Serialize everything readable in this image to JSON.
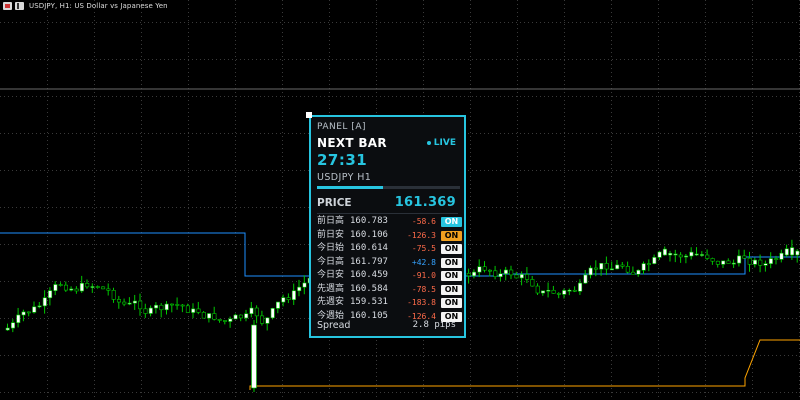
{
  "window": {
    "title": "USDJPY, H1:  US Dollar vs Japanese Yen"
  },
  "panel": {
    "label": "PANEL [A]",
    "heading": "NEXT BAR",
    "status": "LIVE",
    "timer": "27:31",
    "symbol": "USDJPY H1",
    "progress": 0.46,
    "price_label": "PRICE",
    "price_value": "161.369",
    "rows": [
      {
        "name": "前日高",
        "price": "160.783",
        "diff": "-58.6",
        "toggle": "ON",
        "toggle_color": "cyan"
      },
      {
        "name": "前日安",
        "price": "160.106",
        "diff": "-126.3",
        "toggle": "ON",
        "toggle_color": "orange"
      },
      {
        "name": "今日始",
        "price": "160.614",
        "diff": "-75.5",
        "toggle": "ON",
        "toggle_color": "white"
      },
      {
        "name": "今日高",
        "price": "161.797",
        "diff": "+42.8",
        "toggle": "ON",
        "toggle_color": "white"
      },
      {
        "name": "今日安",
        "price": "160.459",
        "diff": "-91.0",
        "toggle": "ON",
        "toggle_color": "white"
      },
      {
        "name": "先週高",
        "price": "160.584",
        "diff": "-78.5",
        "toggle": "ON",
        "toggle_color": "white"
      },
      {
        "name": "先週安",
        "price": "159.531",
        "diff": "-183.8",
        "toggle": "ON",
        "toggle_color": "white"
      },
      {
        "name": "今週始",
        "price": "160.105",
        "diff": "-126.4",
        "toggle": "ON",
        "toggle_color": "white"
      }
    ],
    "spread_label": "Spread",
    "spread_value": "2.8 pips"
  },
  "colors": {
    "accent": "#27c5e0",
    "bull_candle": "#ffffff",
    "bear_candle": "#000000",
    "wick": "#00c800",
    "prev_high_line": "#1e90ff",
    "prev_low_line": "#ffa500"
  },
  "icons": [
    "chart-window-icon",
    "symbol-icon"
  ]
}
